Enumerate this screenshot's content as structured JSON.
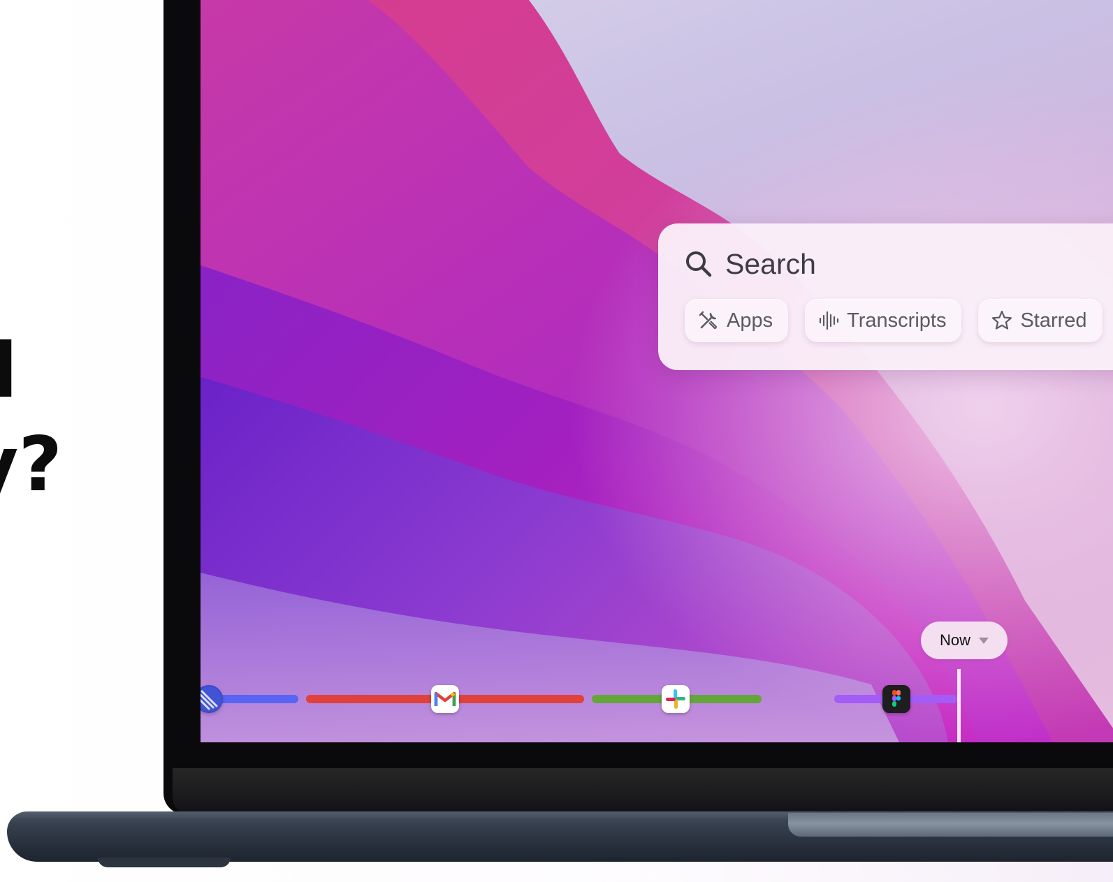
{
  "headline": {
    "line1": "d",
    "line2": "y?"
  },
  "search": {
    "placeholder": "Search"
  },
  "filters": [
    {
      "label": "Apps",
      "icon": "tools-icon"
    },
    {
      "label": "Transcripts",
      "icon": "waveform-icon"
    },
    {
      "label": "Starred",
      "icon": "star-icon"
    }
  ],
  "timeline": {
    "now_label": "Now",
    "segments": [
      {
        "app": "linear",
        "color": "#5865f2"
      },
      {
        "app": "gmail",
        "color": "#e0413b"
      },
      {
        "app": "slack",
        "color": "#63a63a"
      },
      {
        "app": "figma",
        "color": "#a45cf7"
      }
    ]
  }
}
